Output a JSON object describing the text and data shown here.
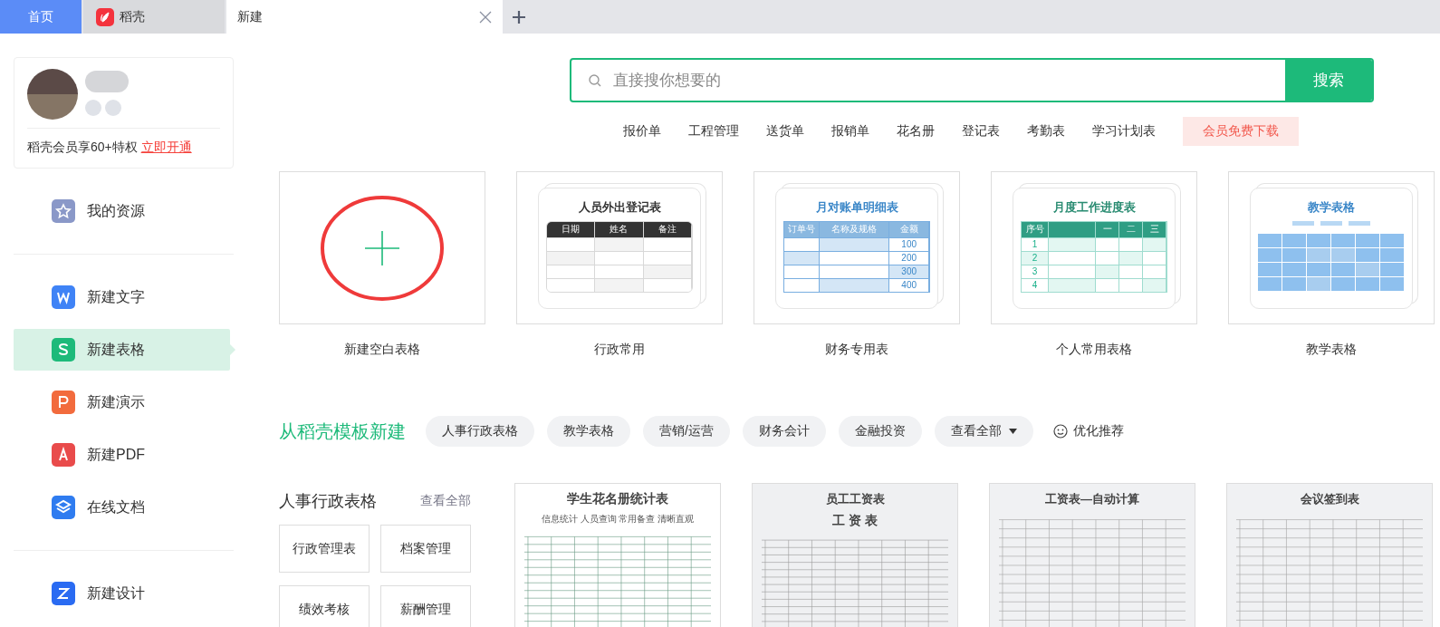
{
  "tabs": [
    {
      "label": "首页",
      "kind": "home",
      "selected": false
    },
    {
      "label": "稻壳",
      "kind": "docer",
      "selected": false
    },
    {
      "label": "新建",
      "kind": "page",
      "selected": true
    }
  ],
  "profile": {
    "promo": "稻壳会员享60+特权",
    "link": "立即开通"
  },
  "nav": [
    [
      {
        "label": "我的资源",
        "kind": "resource",
        "selected": false
      }
    ],
    [
      {
        "label": "新建文字",
        "kind": "writer",
        "selected": false
      },
      {
        "label": "新建表格",
        "kind": "sheet",
        "selected": true
      },
      {
        "label": "新建演示",
        "kind": "slides",
        "selected": false
      },
      {
        "label": "新建PDF",
        "kind": "pdf",
        "selected": false
      },
      {
        "label": "在线文档",
        "kind": "online",
        "selected": false
      }
    ],
    [
      {
        "label": "新建设计",
        "kind": "design",
        "selected": false
      }
    ]
  ],
  "search": {
    "placeholder": "直接搜你想要的",
    "button": "搜索"
  },
  "hot_words": [
    "报价单",
    "工程管理",
    "送货单",
    "报销单",
    "花名册",
    "登记表",
    "考勤表",
    "学习计划表"
  ],
  "vip_button": "会员免费下载",
  "new_cards": [
    {
      "label": "新建空白表格",
      "kind": "blank"
    },
    {
      "label": "行政常用",
      "kind": "plain",
      "title": "人员外出登记表",
      "headers": [
        "日期",
        "姓名",
        "备注"
      ]
    },
    {
      "label": "财务专用表",
      "kind": "ledger",
      "title": "月对账单明细表",
      "headers": [
        "订单号",
        "名称及规格",
        "金额"
      ],
      "row_labels": [
        "100",
        "200",
        "300",
        "400"
      ]
    },
    {
      "label": "个人常用表格",
      "kind": "progress",
      "title": "月度工作进度表",
      "headers": [
        "序号",
        "一",
        "二",
        "三"
      ],
      "row_labels": [
        "1",
        "2",
        "3",
        "4"
      ]
    },
    {
      "label": "教学表格",
      "kind": "teaching",
      "title": "教学表格"
    }
  ],
  "template_title": "从稻壳模板新建",
  "chips": [
    "人事行政表格",
    "教学表格",
    "营销/运营",
    "财务会计",
    "金融投资"
  ],
  "view_all": "查看全部",
  "recommend": "优化推荐",
  "category": {
    "title": "人事行政表格",
    "link": "查看全部",
    "items": [
      "行政管理表",
      "档案管理",
      "绩效考核",
      "薪酬管理"
    ]
  },
  "thumbs": [
    {
      "kind": "roster",
      "title": "学生花名册统计表",
      "subtitle": "信息统计 人员查询 常用备查 清晰直观"
    },
    {
      "kind": "payroll",
      "title": "员工工资表",
      "heading": "工 资 表"
    },
    {
      "kind": "auto",
      "title": "工资表—自动计算"
    },
    {
      "kind": "signin",
      "title": "会议签到表"
    }
  ]
}
